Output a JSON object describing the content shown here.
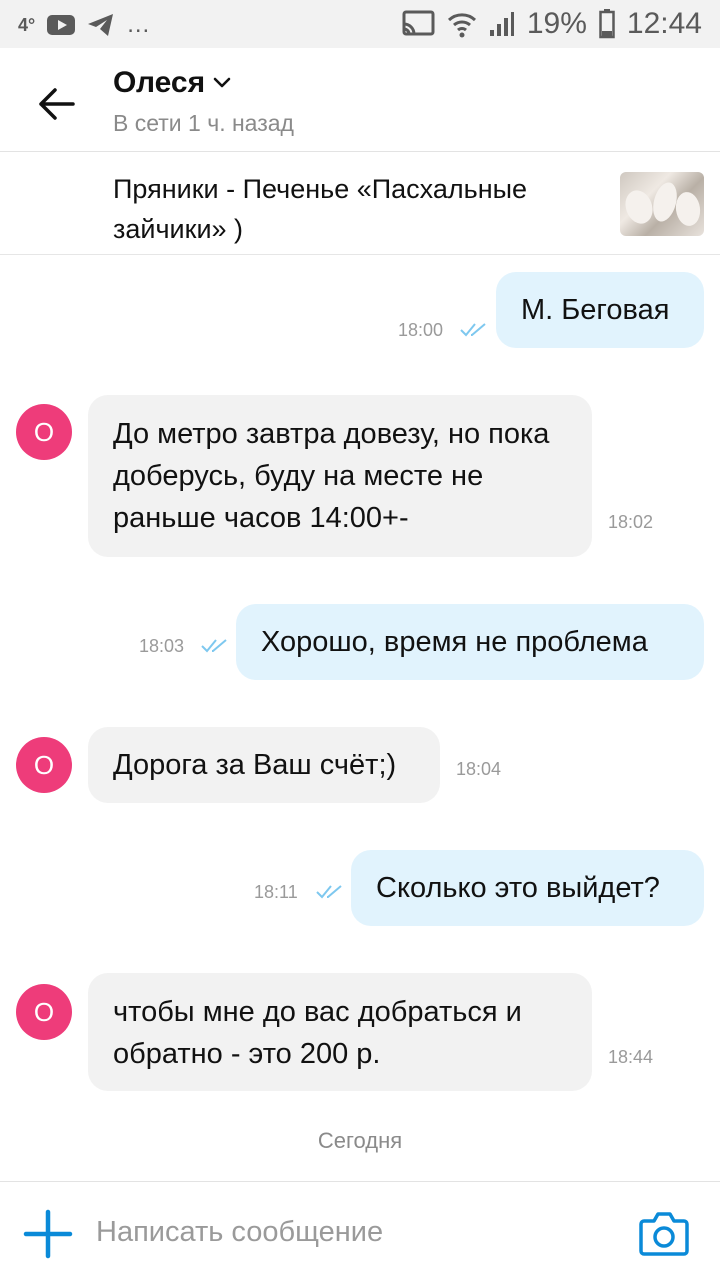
{
  "status_bar": {
    "left_temp": "4°",
    "notif_more": "...",
    "battery": "19%",
    "time": "12:44"
  },
  "header": {
    "name": "Олеся",
    "status": "В сети 1 ч. назад"
  },
  "listing": {
    "title": "Пряники - Печенье «Пасхальные зайчики» )"
  },
  "messages": [
    {
      "dir": "out",
      "text": "М. Беговая",
      "time": "18:00"
    },
    {
      "dir": "in",
      "avatar": "О",
      "text": "До метро завтра довезу, но пока доберусь, буду на месте не раньше часов 14:00+-",
      "time": "18:02"
    },
    {
      "dir": "out",
      "text": "Хорошо, время не проблема",
      "time": "18:03"
    },
    {
      "dir": "in",
      "avatar": "О",
      "text": "Дорога за Ваш счёт;)",
      "time": "18:04"
    },
    {
      "dir": "out",
      "text": "Сколько это выйдет?",
      "time": "18:11"
    },
    {
      "dir": "in",
      "avatar": "О",
      "text": "чтобы мне до вас добраться и обратно - это 200 р.",
      "time": "18:44"
    }
  ],
  "day_separator": "Сегодня",
  "composer": {
    "placeholder": "Написать сообщение"
  },
  "colors": {
    "accent": "#0a8ad8",
    "outgoing_bubble": "#e1f3fd",
    "incoming_bubble": "#f2f2f2",
    "avatar": "#ee3c7a",
    "read_ticks": "#7ec8ef"
  },
  "icons": {
    "back": "arrow-left-icon",
    "dropdown": "chevron-down-icon",
    "read": "double-check-icon",
    "add": "plus-icon",
    "camera": "camera-icon"
  }
}
